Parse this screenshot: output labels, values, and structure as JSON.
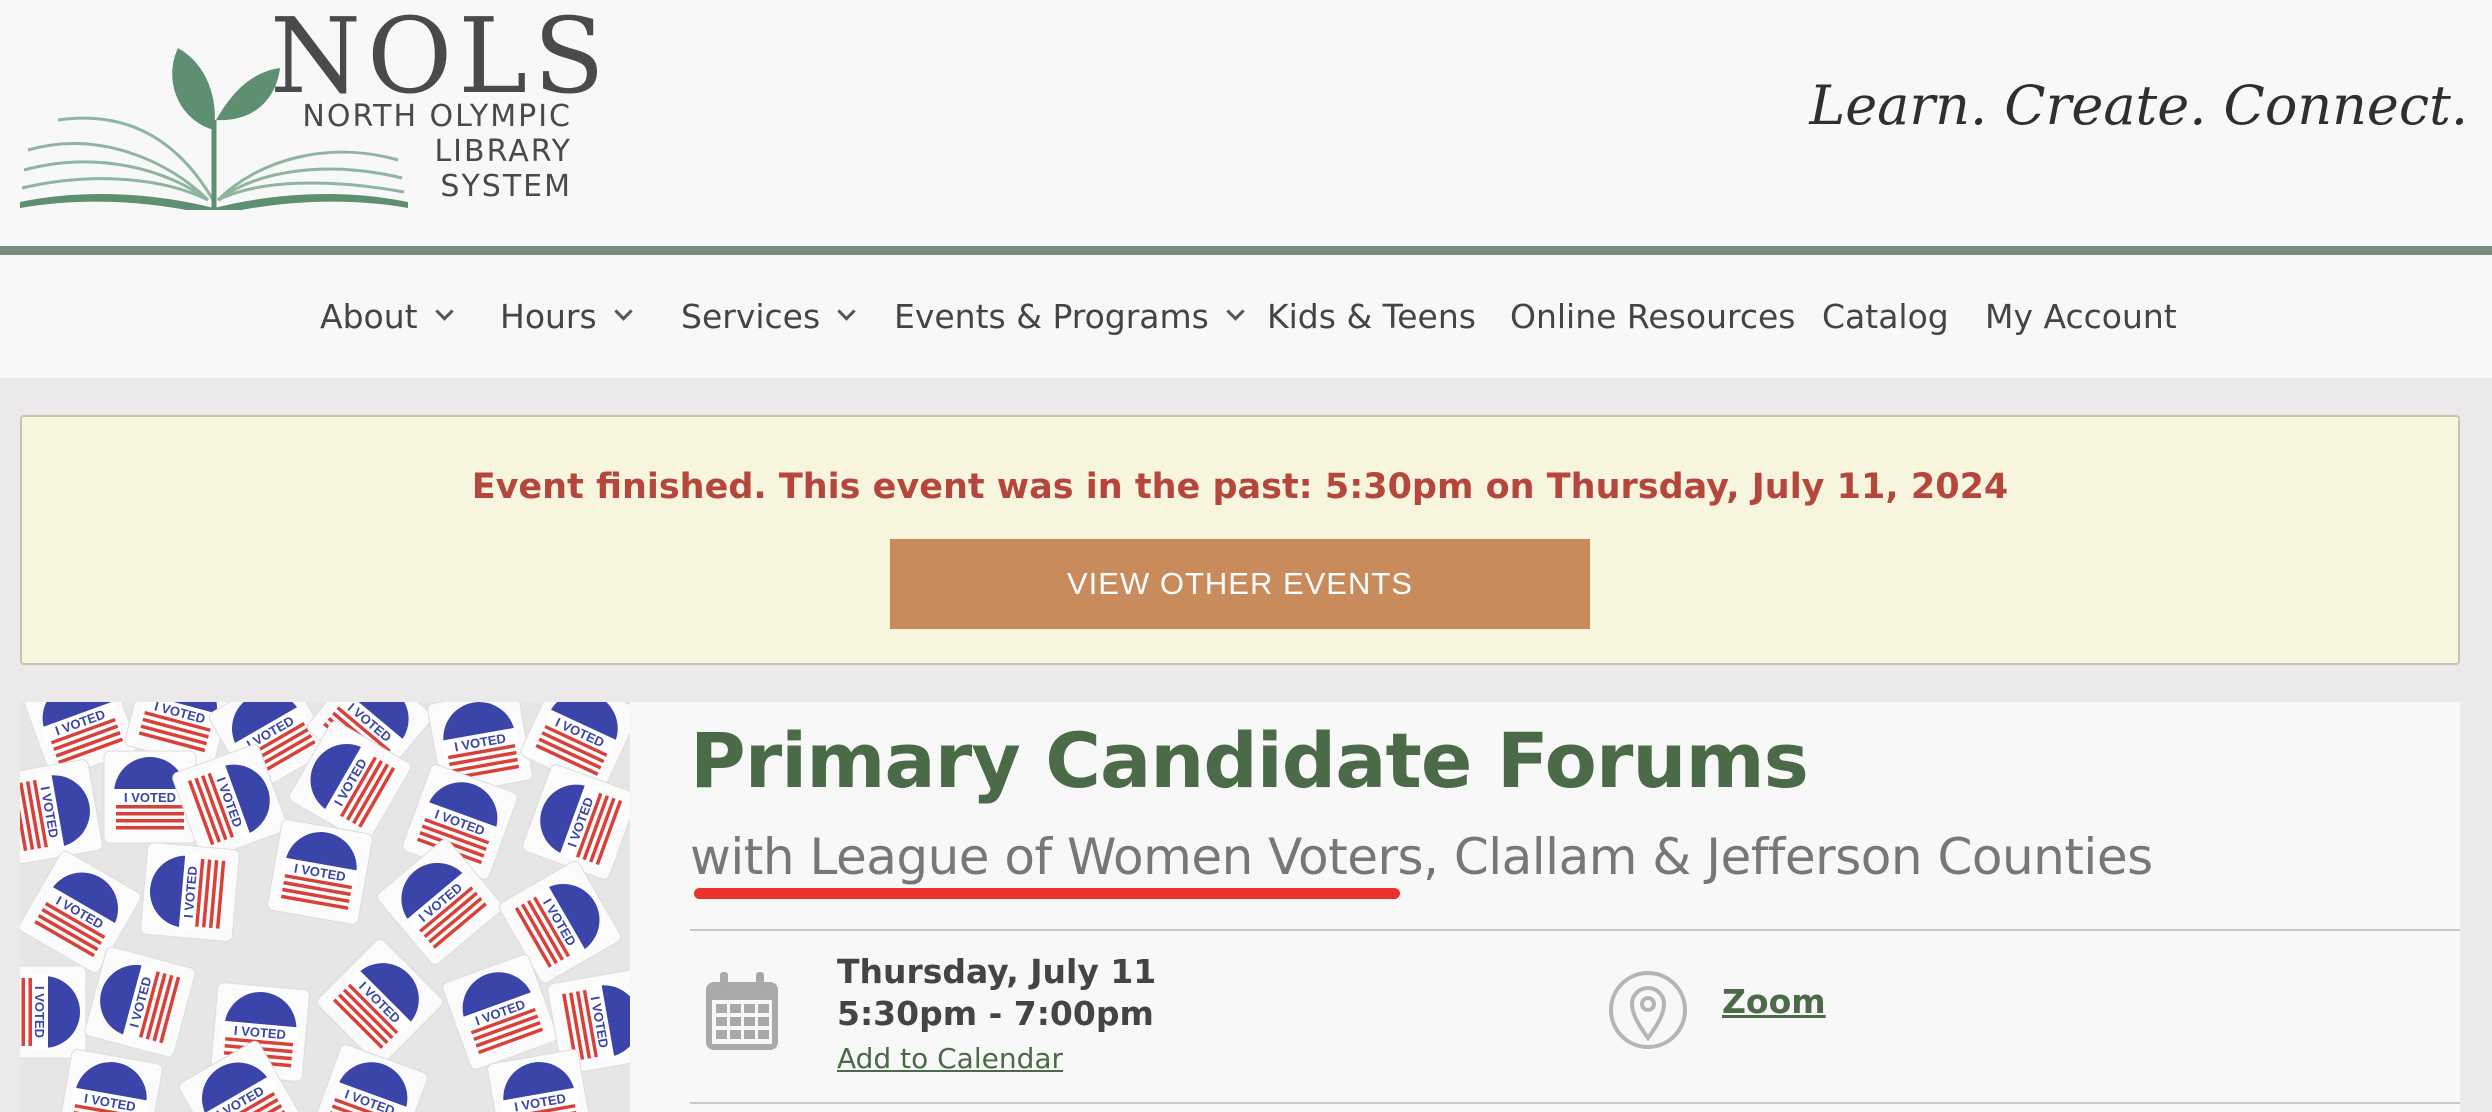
{
  "header": {
    "logo": {
      "big": "NOLS",
      "line1": "NORTH OLYMPIC",
      "line2": "LIBRARY",
      "line3": "SYSTEM"
    },
    "tagline": "Learn. Create. Connect."
  },
  "nav": {
    "items": [
      {
        "label": "About",
        "dropdown": true
      },
      {
        "label": "Hours",
        "dropdown": true
      },
      {
        "label": "Services",
        "dropdown": true
      },
      {
        "label": "Events & Programs",
        "dropdown": true
      },
      {
        "label": "Kids & Teens",
        "dropdown": false
      },
      {
        "label": "Online Resources",
        "dropdown": false
      },
      {
        "label": "Catalog",
        "dropdown": false
      },
      {
        "label": "My Account",
        "dropdown": false
      }
    ]
  },
  "notice": {
    "text": "Event finished. This event was in the past: 5:30pm on Thursday, July 11, 2024",
    "button": "VIEW OTHER EVENTS"
  },
  "event": {
    "title": "Primary Candidate Forums",
    "subtitle": "with League of Women Voters, Clallam & Jefferson Counties",
    "date": "Thursday, July 11",
    "time": "5:30pm - 7:00pm",
    "add_to_calendar": "Add to Calendar",
    "location": "Zoom",
    "image_sticker_text": "I VOTED"
  },
  "colors": {
    "accent_green": "#4b6a47",
    "button_orange": "#c98b5c",
    "notice_red": "#b4463c",
    "annotation_red": "#e8322a"
  }
}
